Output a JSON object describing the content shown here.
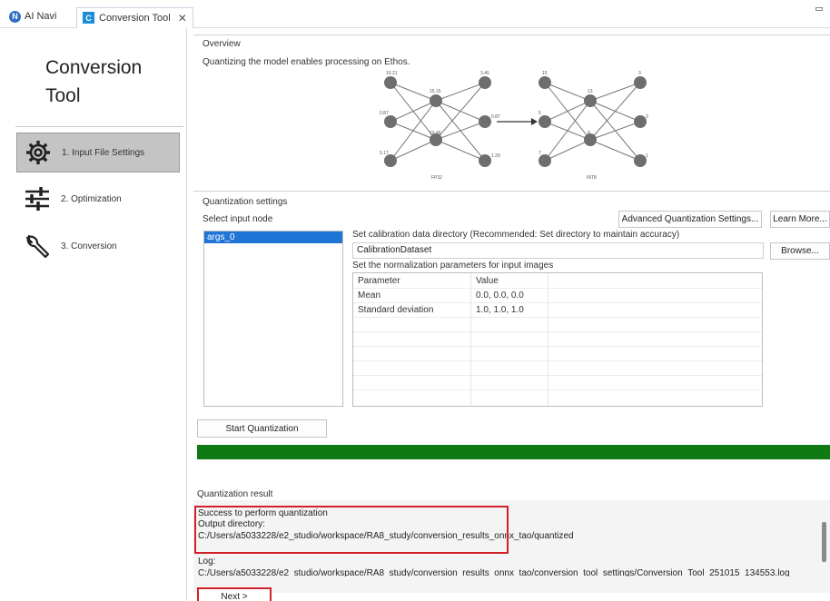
{
  "tabs": [
    {
      "label": "AI Navi",
      "icon": "ai-navi-icon"
    },
    {
      "label": "Conversion Tool",
      "icon": "conversion-tool-icon",
      "active": true
    }
  ],
  "app": {
    "title_line1": "Conversion",
    "title_line2": "Tool"
  },
  "nav": [
    {
      "label": "1. Input File Settings",
      "icon": "gear-icon",
      "active": true
    },
    {
      "label": "2. Optimization",
      "icon": "sliders-icon"
    },
    {
      "label": "3. Conversion",
      "icon": "wrench-icon"
    }
  ],
  "overview": {
    "heading": "Overview",
    "description": "Quantizing the model enables processing on Ethos.",
    "diagram_left_label": "FP32",
    "diagram_right_label": "INT8",
    "fp32_values": [
      "10.21",
      "3.45",
      "0.87",
      "0.87",
      "5.17",
      "1.29",
      "15.15",
      "10.45"
    ],
    "int8_values": [
      "15",
      "3",
      "5",
      "3",
      "7",
      "1",
      "13",
      "8"
    ]
  },
  "quant_settings": {
    "heading": "Quantization settings",
    "select_node_label": "Select input node",
    "nodes": [
      "args_0"
    ],
    "advanced_button": "Advanced Quantization Settings...",
    "learn_more_button": "Learn More...",
    "calib_label": "Set calibration data directory (Recommended: Set directory to maintain accuracy)",
    "calib_value": "CalibrationDataset",
    "browse_button": "Browse...",
    "norm_label": "Set the normalization parameters for input images",
    "table_headers": [
      "Parameter",
      "Value"
    ],
    "table_rows": [
      [
        "Mean",
        "0.0, 0.0, 0.0"
      ],
      [
        "Standard deviation",
        "1.0, 1.0, 1.0"
      ]
    ],
    "start_button": "Start Quantization",
    "progress": 1.0
  },
  "result": {
    "heading": "Quantization result",
    "line1": "Success to perform quantization",
    "line2": "Output directory:",
    "line3": "C:/Users/a5033228/e2_studio/workspace/RA8_study/conversion_results_onnx_tao/quantized",
    "log_label": "Log:",
    "log_path": "C:/Users/a5033228/e2_studio/workspace/RA8_study/conversion_results_onnx_tao/conversion_tool_settings/Conversion_Tool_251015_134553.log"
  },
  "next_button": "Next >",
  "colors": {
    "accent": "#1f74d6",
    "progress": "#0f7a14",
    "highlight": "#d2202a"
  }
}
